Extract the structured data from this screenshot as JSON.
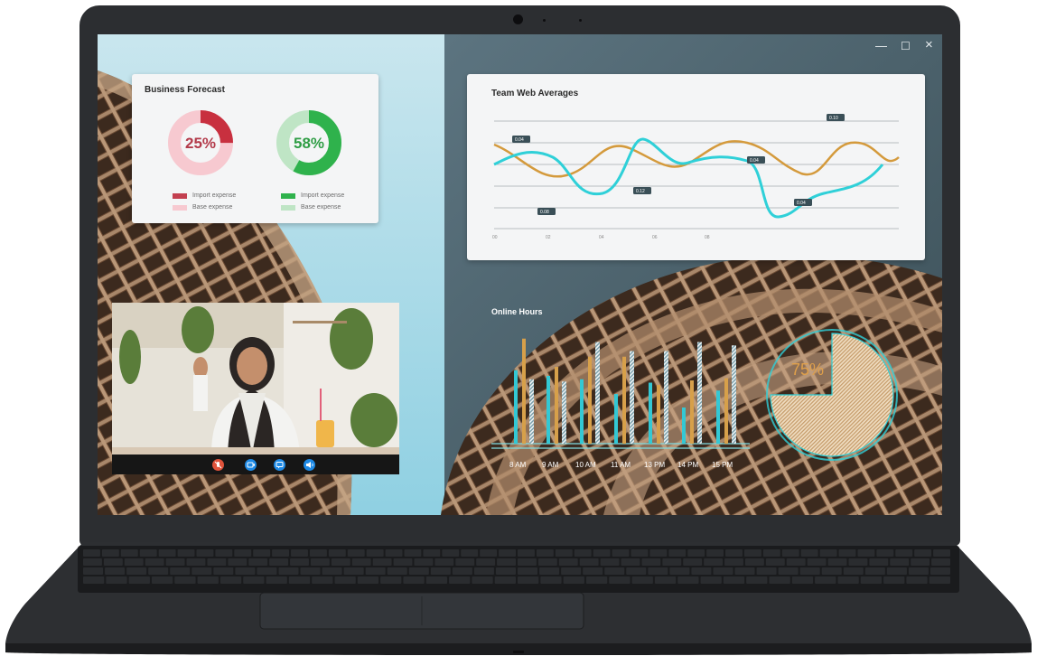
{
  "window": {
    "minimize_glyph": "—",
    "maximize_glyph": "☐",
    "close_glyph": "×"
  },
  "business_forecast": {
    "title": "Business Forecast",
    "donuts": [
      {
        "value_label": "25%",
        "value": 0.25,
        "color": "#c8303f",
        "track_color": "#f7c9d0"
      },
      {
        "value_label": "58%",
        "value": 0.58,
        "color": "#2fb24c",
        "track_color": "#bfe5c5"
      }
    ],
    "legends": [
      [
        {
          "label": "Import expense",
          "color": "#c34050"
        },
        {
          "label": "Base expense",
          "color": "#f7c9d0"
        }
      ],
      [
        {
          "label": "Import expense",
          "color": "#2fb24c"
        },
        {
          "label": "Base expense",
          "color": "#bfe5c5"
        }
      ]
    ]
  },
  "team_web_averages": {
    "title": "Team Web Averages",
    "x_ticks": [
      "00",
      "02",
      "04",
      "06",
      "08"
    ],
    "callouts": [
      "0.04",
      "0.08",
      "0.12",
      "0.04",
      "0.10",
      "0.04"
    ]
  },
  "video_call": {
    "buttons": [
      {
        "name": "mute-mic-button",
        "icon": "mic-off-icon",
        "color": "#e0533b"
      },
      {
        "name": "camera-button",
        "icon": "video-camera-icon",
        "color": "#1e8ae6"
      },
      {
        "name": "chat-button",
        "icon": "chat-icon",
        "color": "#1e8ae6"
      },
      {
        "name": "speaker-button",
        "icon": "speaker-icon",
        "color": "#1e8ae6"
      }
    ]
  },
  "online_hours": {
    "title": "Online Hours",
    "pie_label": "75%",
    "pie_value": 0.75
  },
  "chart_data": [
    {
      "type": "bar",
      "title": "Online Hours",
      "categories": [
        "8 AM",
        "9 AM",
        "10 AM",
        "11 AM",
        "13 PM",
        "14 PM",
        "15 PM"
      ],
      "series": [
        {
          "values": [
            0.65,
            0.6,
            0.57,
            0.44,
            0.54,
            0.32,
            0.47
          ],
          "color": "#33c8d4"
        },
        {
          "values": [
            0.93,
            0.68,
            0.77,
            0.77,
            0.52,
            0.56,
            0.58
          ],
          "color": "#d7a04a"
        },
        {
          "values": [
            0.57,
            0.55,
            0.9,
            0.82,
            0.82,
            0.9,
            0.87
          ],
          "color": "#dfe6e8",
          "striped": true
        }
      ],
      "ylim": [
        0,
        1
      ],
      "grid": false
    }
  ],
  "colors": {
    "lid": "#2c2e31",
    "teal": "#33c8d4",
    "gold": "#d7a04a"
  }
}
